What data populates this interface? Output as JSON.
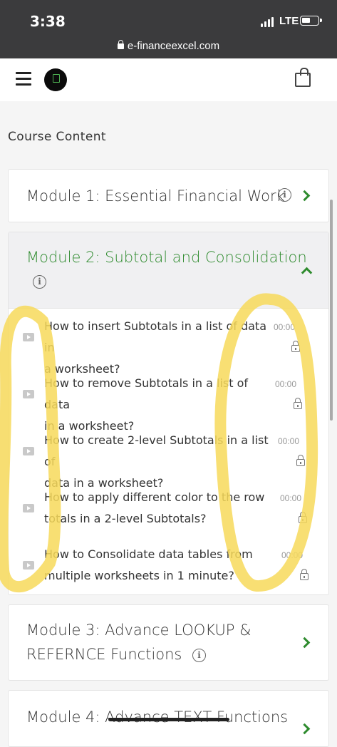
{
  "status": {
    "time": "3:38",
    "network": "LTE"
  },
  "browser": {
    "url": "e-financeexcel.com"
  },
  "nav": {
    "menu_icon": "hamburger-menu-icon",
    "logo": "e-finance-excel-logo",
    "cart_icon": "shopping-bag-icon"
  },
  "page": {
    "title": "Course Content"
  },
  "modules": [
    {
      "title": "Module 1: Essential Financial Work",
      "expanded": false
    },
    {
      "title": "Module 2: Subtotal and Consolidation",
      "expanded": true,
      "lessons": [
        {
          "line1": "How to insert Subtotals in a list of data in",
          "line2": "a worksheet?",
          "duration": "00:00"
        },
        {
          "line1": "How to remove Subtotals in a list of data",
          "line2": "in a worksheet?",
          "duration": "00:00"
        },
        {
          "line1": "How to create 2-level Subtotals in a list of",
          "line2": "data in a worksheet?",
          "duration": "00:00"
        },
        {
          "line1": "How to apply different color to the row",
          "line2": "totals in a 2-level Subtotals?",
          "duration": "00:00"
        },
        {
          "line1": "How to Consolidate data tables from",
          "line2": "multiple worksheets in 1 minute?",
          "duration": "00:00"
        }
      ]
    },
    {
      "title_line1": "Module 3: Advance LOOKUP &",
      "title_line2": "REFERNCE Functions",
      "expanded": false
    },
    {
      "title": "Module 4: Advance TEXT Functions",
      "expanded": false
    }
  ],
  "colors": {
    "accent": "#2e8b2e",
    "annotation": "#f7d95a",
    "statusbar": "#3b3b3d"
  }
}
